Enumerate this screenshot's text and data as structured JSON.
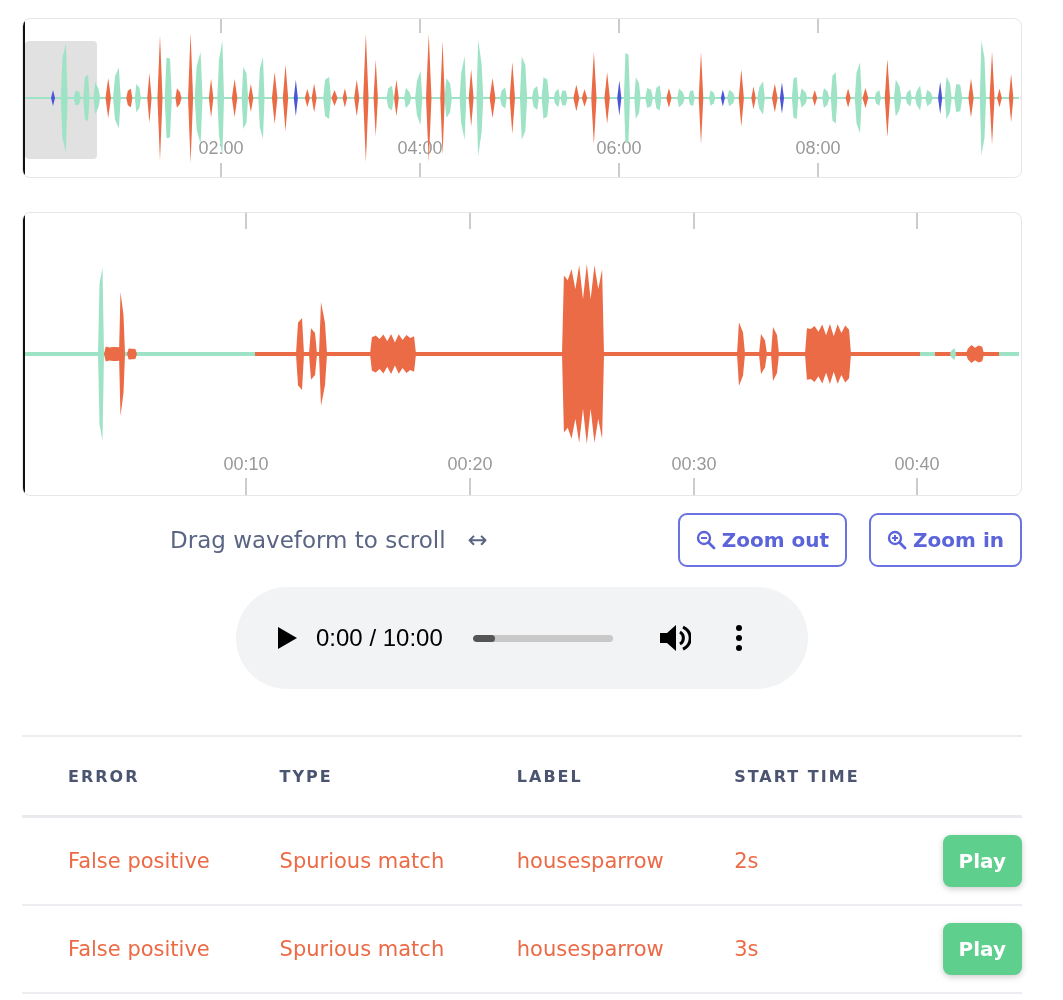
{
  "overview": {
    "tick_labels": [
      "02:00",
      "04:00",
      "06:00",
      "08:00"
    ]
  },
  "detail": {
    "tick_labels": [
      "00:10",
      "00:20",
      "00:30",
      "00:40"
    ]
  },
  "hint": {
    "text": "Drag waveform to scroll",
    "arrow": "↔"
  },
  "zoom_buttons": [
    {
      "label": "Zoom out",
      "kind": "out"
    },
    {
      "label": "Zoom in",
      "kind": "in"
    }
  ],
  "player": {
    "time": "0:00 / 10:00",
    "level": 0.16
  },
  "table": {
    "columns": [
      "ERROR",
      "TYPE",
      "LABEL",
      "START TIME"
    ],
    "rows": [
      {
        "error": "False positive",
        "type": "Spurious match",
        "label": "housesparrow",
        "start_time": "2s",
        "action": "Play"
      },
      {
        "error": "False positive",
        "type": "Spurious match",
        "label": "housesparrow",
        "start_time": "3s",
        "action": "Play"
      }
    ]
  }
}
